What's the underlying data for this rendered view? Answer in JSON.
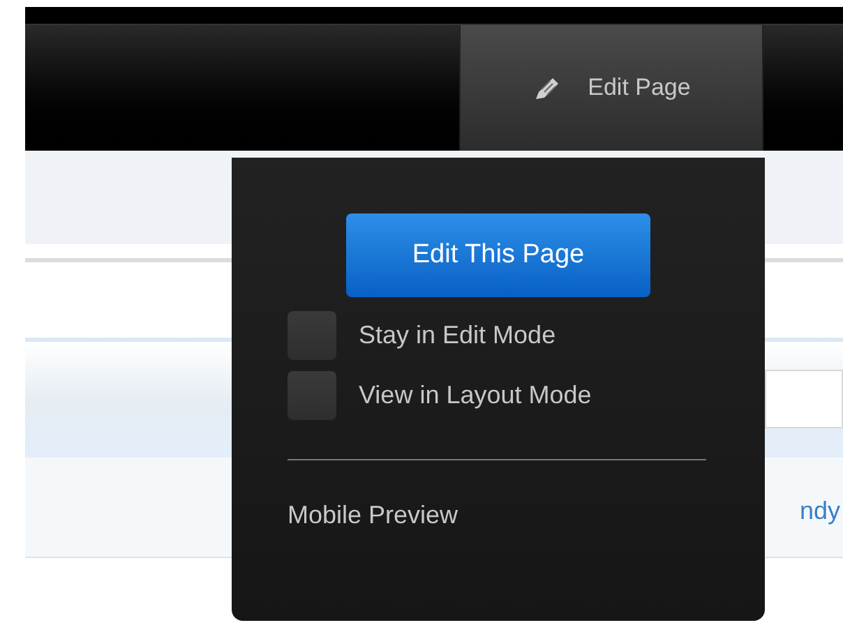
{
  "toolbar": {
    "edit_tab": {
      "label": "Edit Page",
      "selected": true
    }
  },
  "dropdown": {
    "primary_button": "Edit This Page",
    "options": [
      {
        "label": "Stay in Edit Mode",
        "checked": false
      },
      {
        "label": "View in Layout Mode",
        "checked": false
      }
    ],
    "links": [
      "Mobile Preview"
    ]
  },
  "page": {
    "partial_link": "ndy"
  }
}
